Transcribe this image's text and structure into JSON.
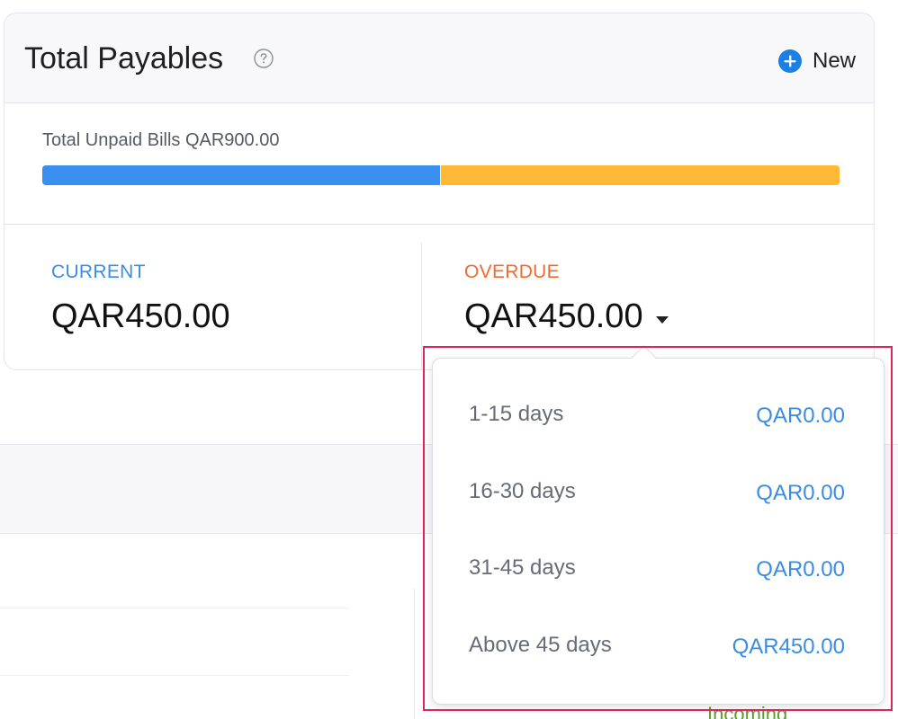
{
  "card": {
    "title": "Total Payables",
    "new_label": "New",
    "unpaid_label": "Total Unpaid Bills QAR900.00",
    "current_fraction": 0.5
  },
  "current": {
    "label": "CURRENT",
    "value": "QAR450.00"
  },
  "overdue": {
    "label": "OVERDUE",
    "value": "QAR450.00"
  },
  "aging": [
    {
      "range": "1-15 days",
      "amount": "QAR0.00"
    },
    {
      "range": "16-30 days",
      "amount": "QAR0.00"
    },
    {
      "range": "31-45 days",
      "amount": "QAR0.00"
    },
    {
      "range": "Above 45 days",
      "amount": "QAR450.00"
    }
  ],
  "background": {
    "incoming_label": "Incoming"
  },
  "colors": {
    "current": "#3a90f1",
    "overdue": "#ffb937",
    "overdue_label": "#f06a33",
    "accent": "#3a8ce6",
    "highlight": "#e0245e"
  },
  "icons": {
    "help": "question-circle-icon",
    "new": "plus-circle-icon",
    "dropdown": "caret-down-icon"
  }
}
